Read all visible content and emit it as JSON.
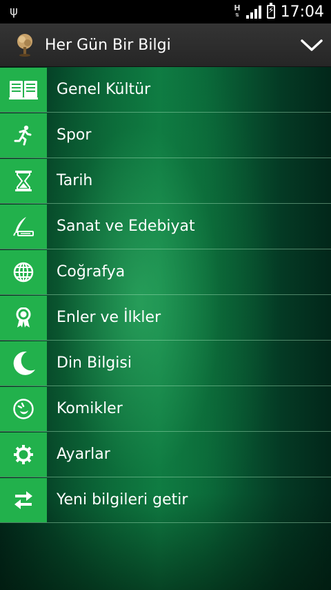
{
  "status_bar": {
    "usb_icon": "usb-icon",
    "network_type": "H",
    "time": "17:04"
  },
  "action_bar": {
    "title": "Her Gün Bir Bilgi",
    "app_icon": "tree-icon",
    "toggle_icon": "chevron-down-icon"
  },
  "menu": {
    "items": [
      {
        "label": "Genel Kültür",
        "icon": "book-icon"
      },
      {
        "label": "Spor",
        "icon": "runner-icon"
      },
      {
        "label": "Tarih",
        "icon": "hourglass-icon"
      },
      {
        "label": "Sanat ve Edebiyat",
        "icon": "quill-icon"
      },
      {
        "label": "Coğrafya",
        "icon": "globe-icon"
      },
      {
        "label": "Enler ve İlkler",
        "icon": "award-icon"
      },
      {
        "label": "Din Bilgisi",
        "icon": "crescent-icon"
      },
      {
        "label": "Komikler",
        "icon": "laugh-icon"
      },
      {
        "label": "Ayarlar",
        "icon": "gear-icon"
      },
      {
        "label": "Yeni bilgileri getir",
        "icon": "swap-arrows-icon"
      }
    ]
  },
  "colors": {
    "icon_box": "#22b14c",
    "action_bar": "#2e2e2e",
    "background": "#0a6a3a"
  }
}
